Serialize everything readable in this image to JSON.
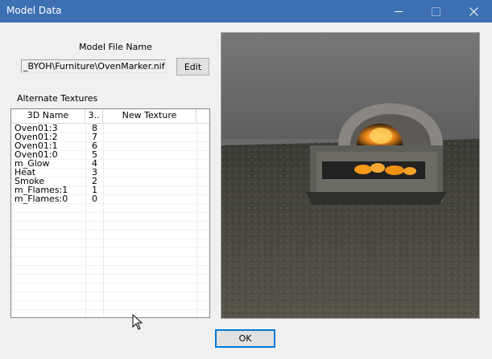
{
  "window": {
    "title": "Model Data"
  },
  "model_file": {
    "label": "Model File Name",
    "path": "_BYOH\\Furniture\\OvenMarker.nif",
    "edit_label": "Edit"
  },
  "textures": {
    "label": "Alternate Textures",
    "columns": [
      "3D Name",
      "3..",
      "New Texture"
    ],
    "rows": [
      {
        "name": "Oven01:3",
        "index": "8",
        "new": ""
      },
      {
        "name": "Oven01:2",
        "index": "7",
        "new": ""
      },
      {
        "name": "Oven01:1",
        "index": "6",
        "new": ""
      },
      {
        "name": "Oven01:0",
        "index": "5",
        "new": ""
      },
      {
        "name": "m_Glow",
        "index": "4",
        "new": ""
      },
      {
        "name": "Heat",
        "index": "3",
        "new": ""
      },
      {
        "name": "Smoke",
        "index": "2",
        "new": ""
      },
      {
        "name": "m_Flames:1",
        "index": "1",
        "new": ""
      },
      {
        "name": "m_Flames:0",
        "index": "0",
        "new": ""
      }
    ]
  },
  "footer": {
    "ok_label": "OK"
  },
  "colors": {
    "titlebar": "#3d6fb3",
    "focus_border": "#0078d7"
  }
}
